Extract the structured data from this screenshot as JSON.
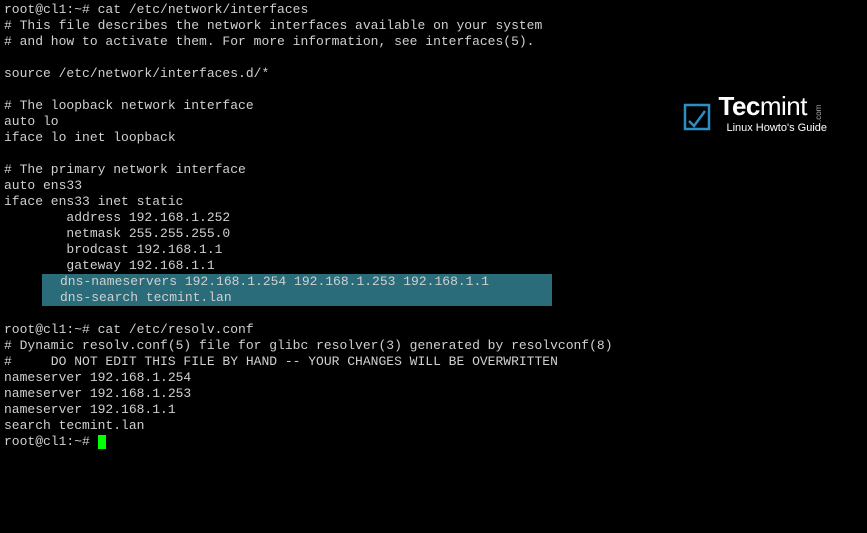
{
  "prompt1": "root@cl1:~# ",
  "cmd1": "cat /etc/network/interfaces",
  "file1": {
    "l1": "# This file describes the network interfaces available on your system",
    "l2": "# and how to activate them. For more information, see interfaces(5).",
    "l3": "source /etc/network/interfaces.d/*",
    "l4": "# The loopback network interface",
    "l5": "auto lo",
    "l6": "iface lo inet loopback",
    "l7": "# The primary network interface",
    "l8": "auto ens33",
    "l9": "iface ens33 inet static",
    "l10": "        address 192.168.1.252",
    "l11": "        netmask 255.255.255.0",
    "l12": "        brodcast 192.168.1.1",
    "l13": "        gateway 192.168.1.1",
    "h1": "dns-nameservers 192.168.1.254 192.168.1.253 192.168.1.1",
    "h2": "dns-search tecmint.lan"
  },
  "prompt2": "root@cl1:~# ",
  "cmd2": "cat /etc/resolv.conf",
  "file2": {
    "l1": "# Dynamic resolv.conf(5) file for glibc resolver(3) generated by resolvconf(8)",
    "l2": "#     DO NOT EDIT THIS FILE BY HAND -- YOUR CHANGES WILL BE OVERWRITTEN",
    "l3": "nameserver 192.168.1.254",
    "l4": "nameserver 192.168.1.253",
    "l5": "nameserver 192.168.1.1",
    "l6": "search tecmint.lan"
  },
  "prompt3": "root@cl1:~# ",
  "logo": {
    "tec": "Tec",
    "mint": "mint",
    "dotcom": ".com",
    "sub": "Linux Howto's Guide"
  }
}
